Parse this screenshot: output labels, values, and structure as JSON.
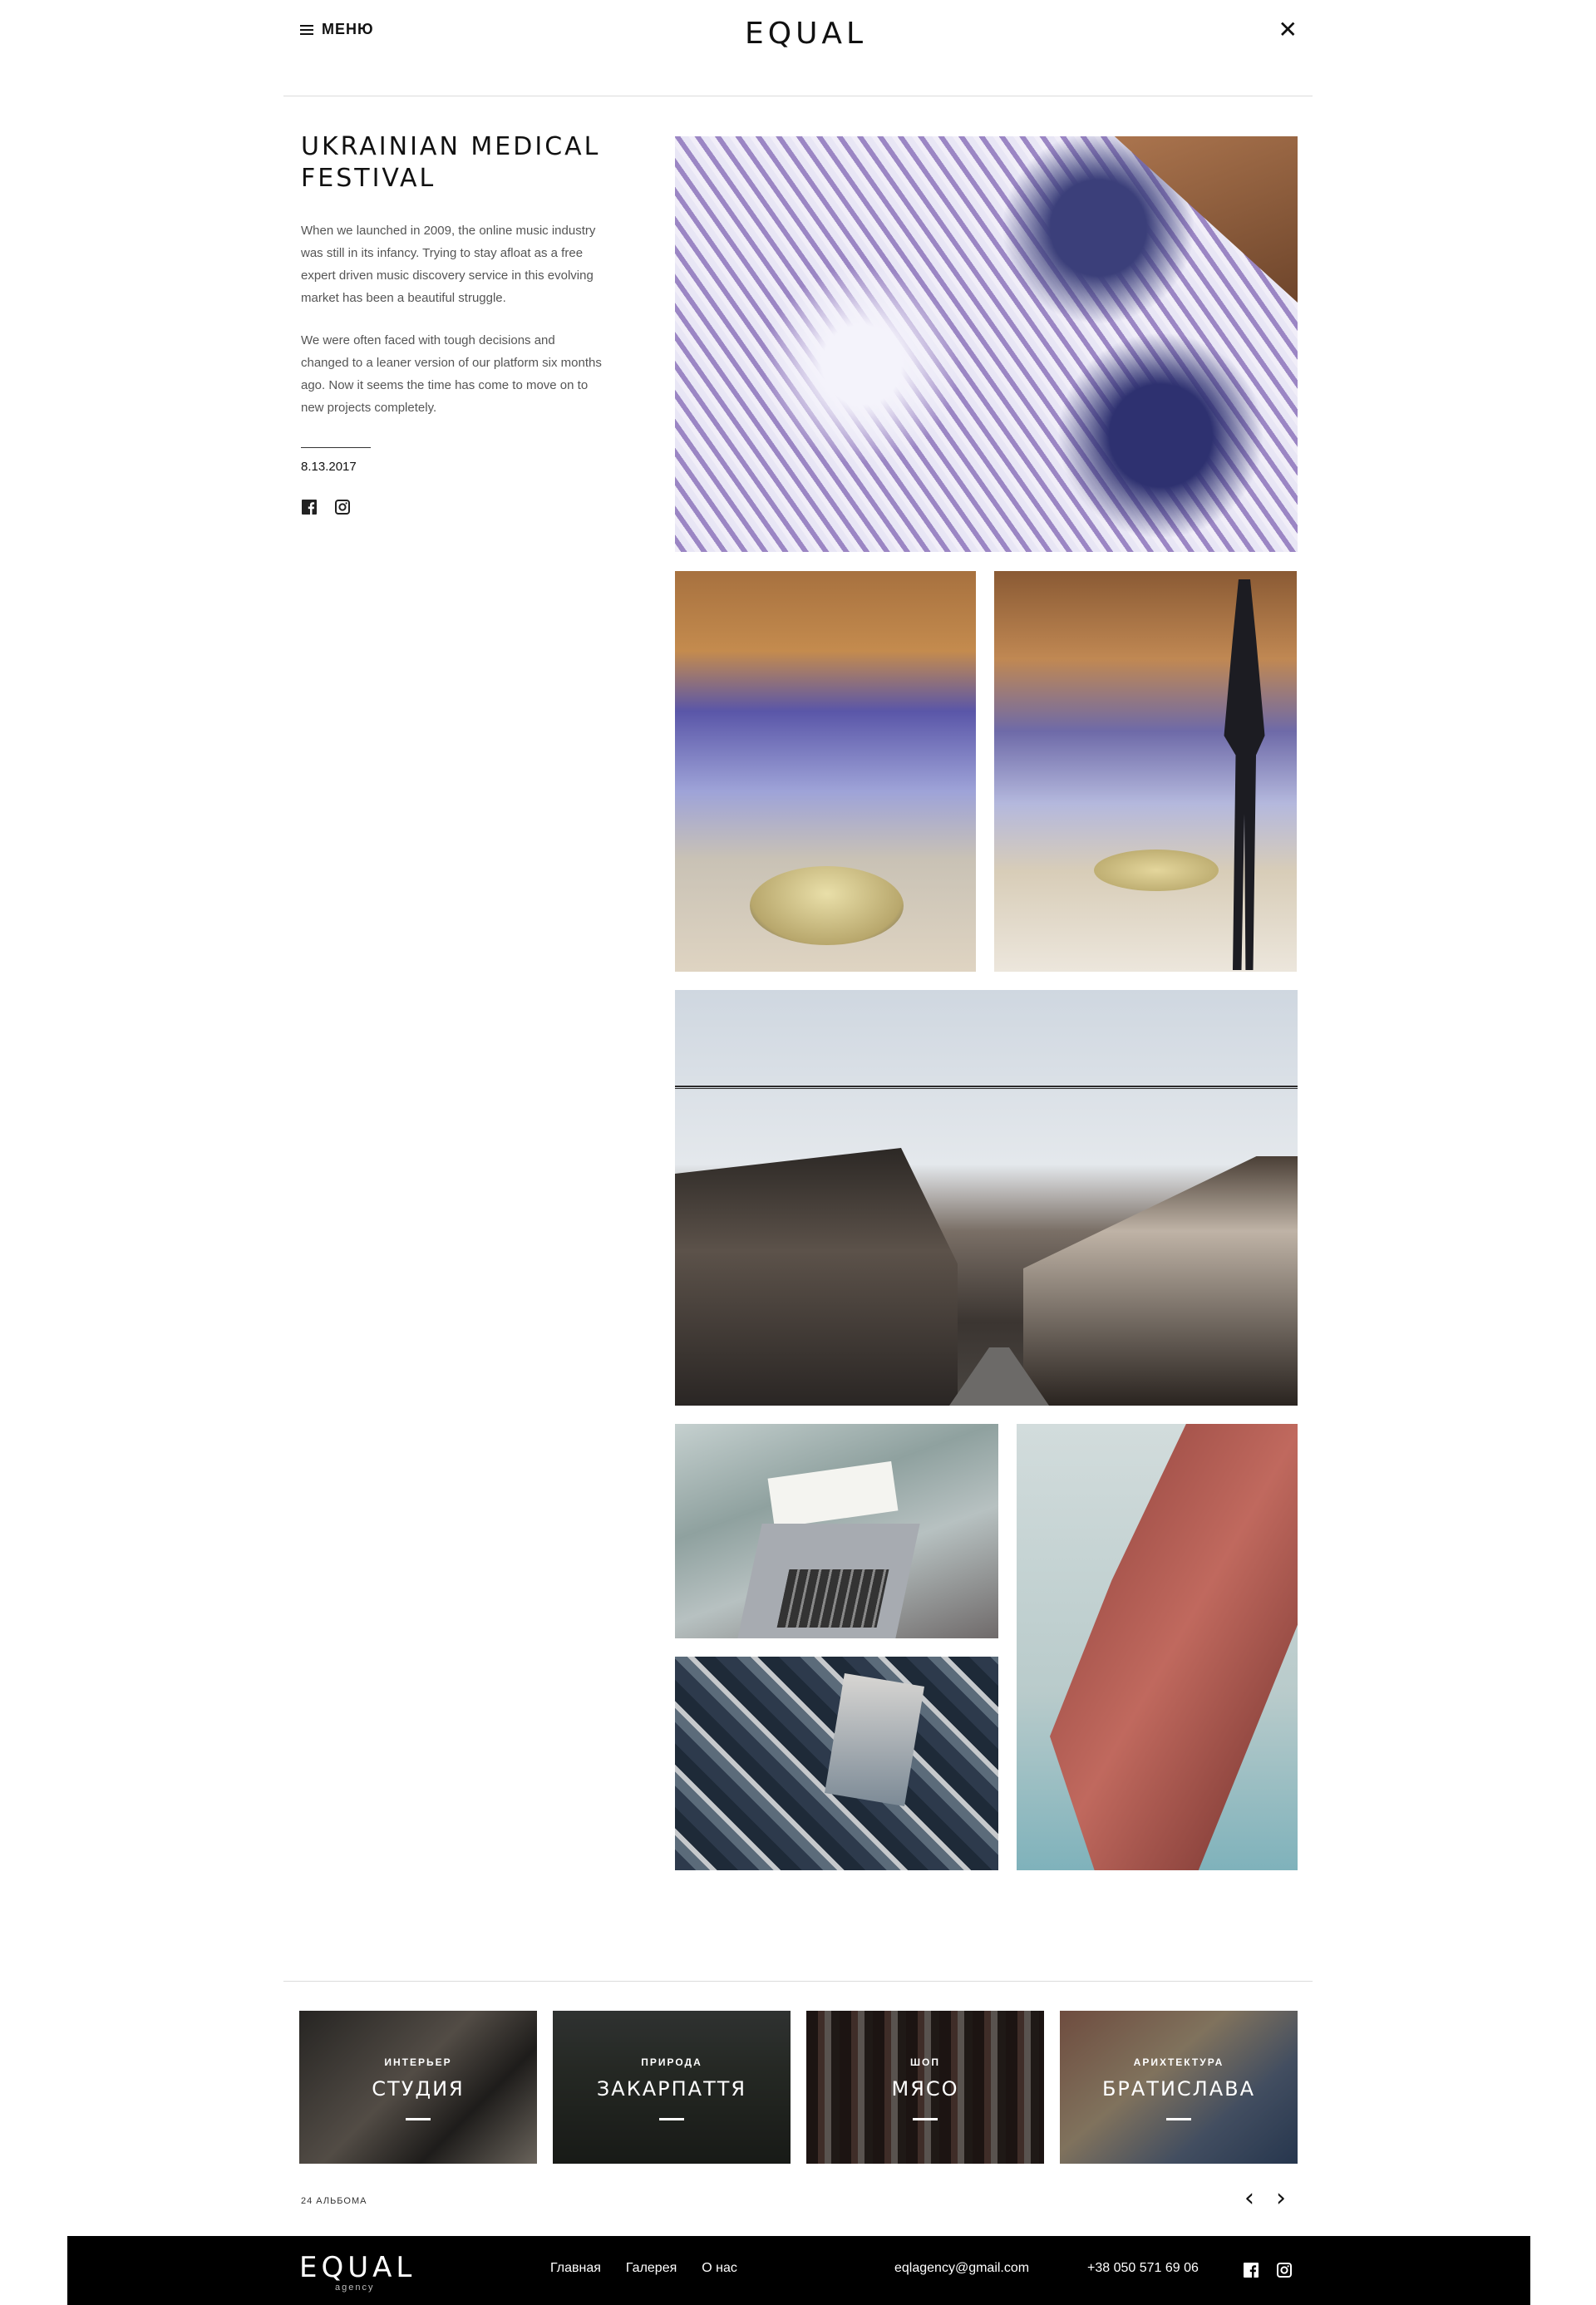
{
  "header": {
    "menu_label": "МЕНЮ",
    "logo": "EQUAL",
    "close_icon": "close-icon"
  },
  "article": {
    "title": "UKRAINIAN MEDICAL FESTIVAL",
    "paragraph1": "When we launched in 2009, the online music industry was still in its infancy. Trying to stay afloat as a free expert driven music discovery service in this evolving market has been a beautiful struggle.",
    "paragraph2": "We were often faced with tough decisions and changed to a leaner version of our platform six months ago. Now it seems the time has come to move on to new projects completely.",
    "date": "8.13.2017",
    "social_icons": [
      "facebook-icon",
      "instagram-icon"
    ]
  },
  "albums": [
    {
      "category": "ИНТЕРЬЕР",
      "name": "СТУДИЯ"
    },
    {
      "category": "ПРИРОДА",
      "name": "ЗАКАРПАТТЯ"
    },
    {
      "category": "ШОП",
      "name": "МЯСО"
    },
    {
      "category": "АРИХТЕКТУРА",
      "name": "БРАТИСЛАВА"
    }
  ],
  "album_count": "24 АЛЬБОМА",
  "footer": {
    "logo": "EQUAL",
    "logo_sub": "agency",
    "nav": [
      "Главная",
      "Галерея",
      "О нас"
    ],
    "email": "eqlagency@gmail.com",
    "phone": "+38 050 571 69 06"
  },
  "colors": {
    "background": "#ffffff",
    "footer_bg": "#000000",
    "text": "#111111",
    "muted_text": "#555555"
  }
}
